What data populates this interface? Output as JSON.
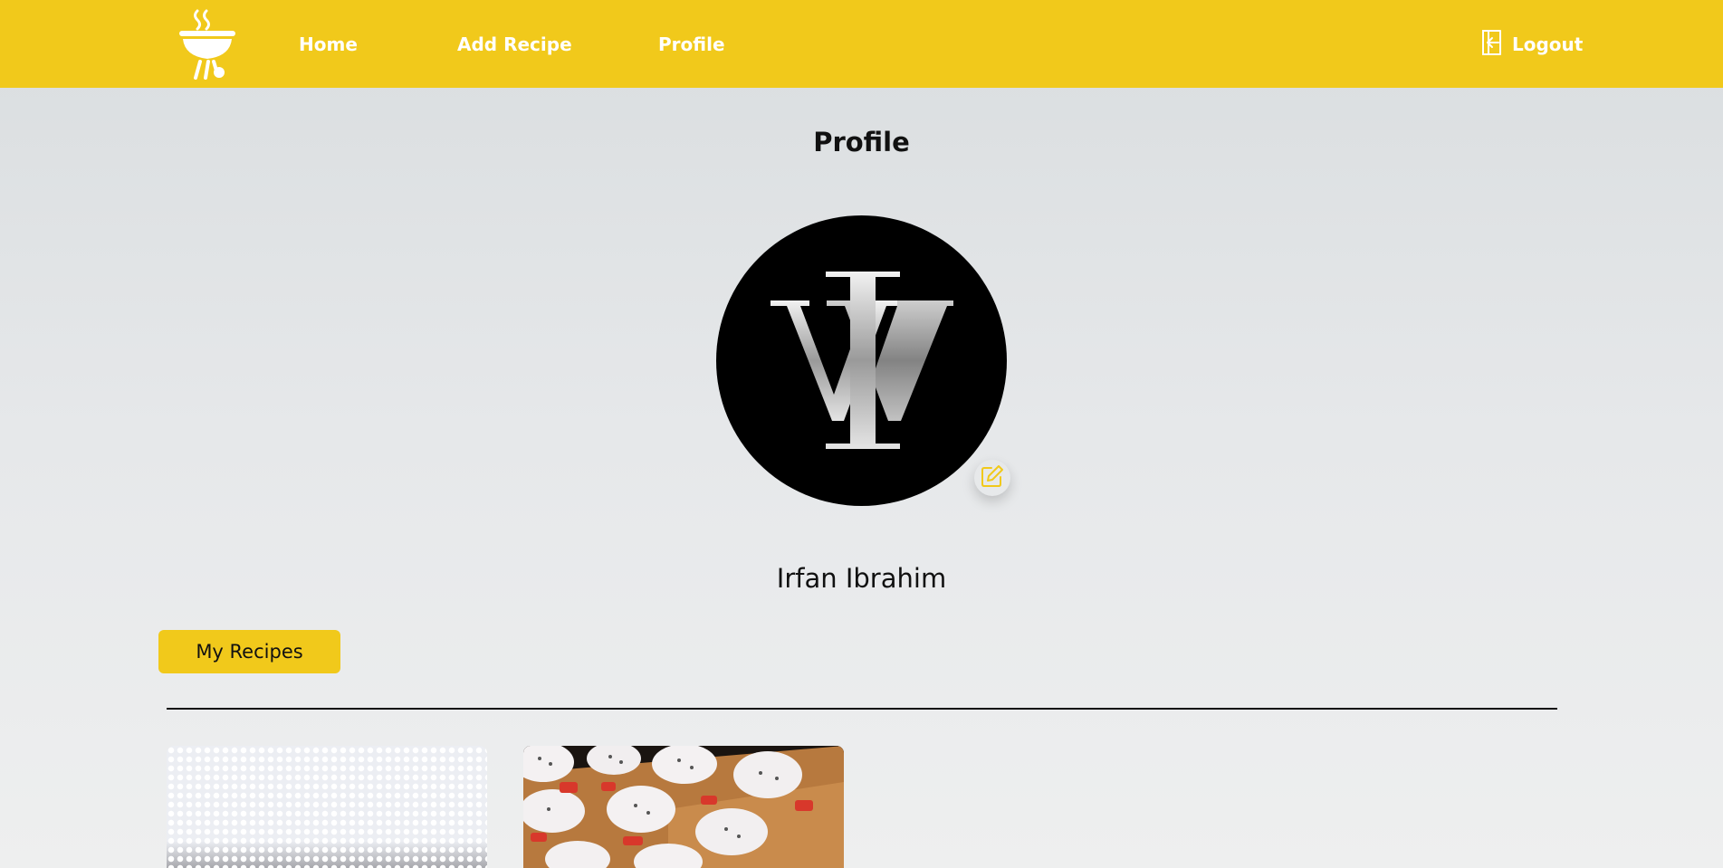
{
  "nav": {
    "logo_icon": "grill-logo-icon",
    "links": [
      {
        "label": "Home"
      },
      {
        "label": "Add Recipe"
      },
      {
        "label": "Profile"
      }
    ],
    "logout_label": "Logout",
    "logout_icon": "logout-icon",
    "color": "#f1c91b"
  },
  "profile": {
    "title": "Profile",
    "name": "Irfan Ibrahim",
    "avatar_icon": "monogram-avatar",
    "edit_icon": "edit-pencil-icon",
    "accent_color": "#f1c91b"
  },
  "recipes": {
    "tab_label": "My Recipes",
    "cards": [
      {
        "image": "placeholder-pattern-image"
      },
      {
        "image": "dessert-cups-image"
      }
    ]
  }
}
